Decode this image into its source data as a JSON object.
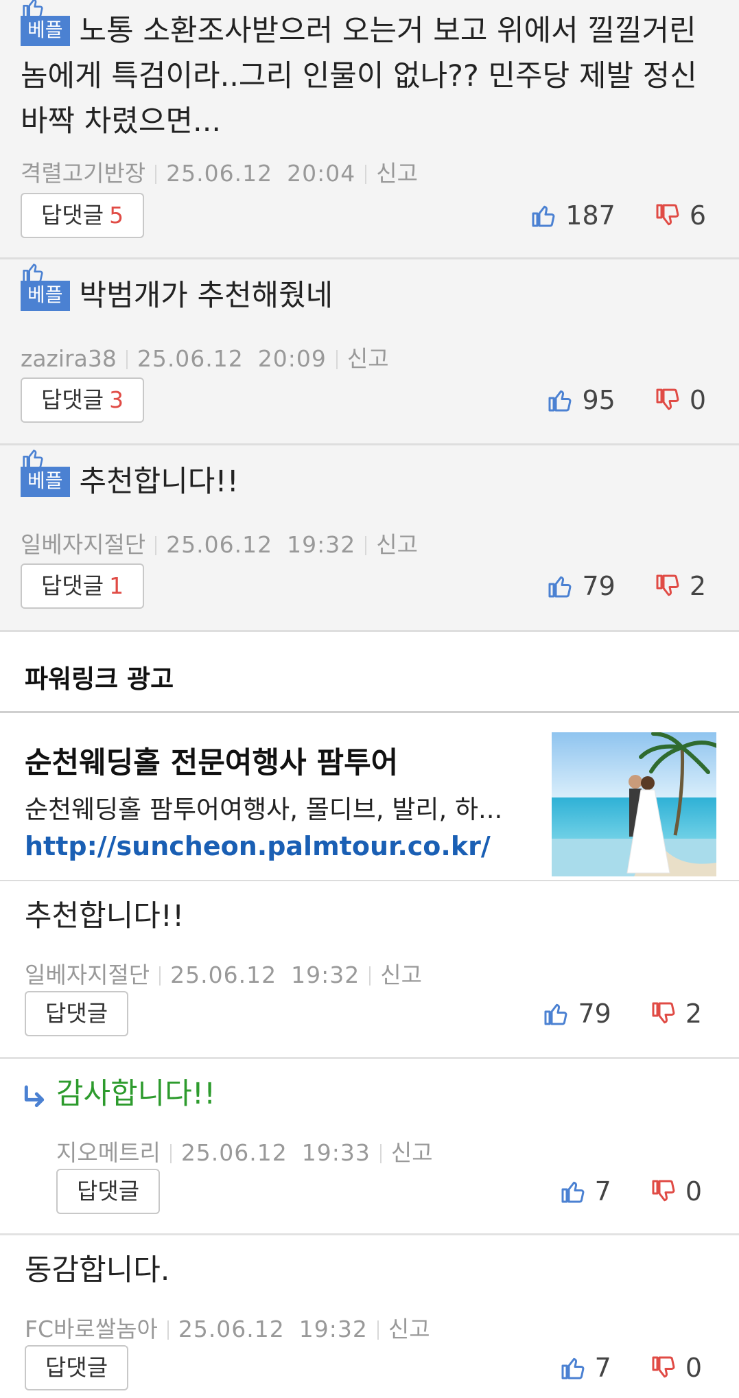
{
  "best_label": "베플",
  "report_label": "신고",
  "reply_label": "답댓글",
  "best_comments": [
    {
      "text": "노통 소환조사받으러 오는거 보고 위에서 낄낄거린 놈에게 특검이라..그리 인물이 없나?? 민주당 제발 정신 바짝 차렸으면...",
      "author": "격렬고기반장",
      "date": "25.06.12",
      "time": "20:04",
      "reply_count": "5",
      "up": "187",
      "down": "6"
    },
    {
      "text": "박범개가 추천해줬네",
      "author": "zazira38",
      "date": "25.06.12",
      "time": "20:09",
      "reply_count": "3",
      "up": "95",
      "down": "0"
    },
    {
      "text": "추천합니다!!",
      "author": "일베자지절단",
      "date": "25.06.12",
      "time": "19:32",
      "reply_count": "1",
      "up": "79",
      "down": "2"
    }
  ],
  "ad_section": {
    "header": "파워링크 광고",
    "title": "순천웨딩홀 전문여행사 팜투어",
    "description": "순천웨딩홀 팜투어여행사, 몰디브, 발리, 하...",
    "url": "http://suncheon.palmtour.co.kr/"
  },
  "comments": [
    {
      "text": "추천합니다!!",
      "author": "일베자지절단",
      "date": "25.06.12",
      "time": "19:32",
      "up": "79",
      "down": "2"
    },
    {
      "text": "감사합니다!!",
      "author": "지오메트리",
      "date": "25.06.12",
      "time": "19:33",
      "up": "7",
      "down": "0"
    },
    {
      "text": "동감합니다.",
      "author": "FC바로쌀놈아",
      "date": "25.06.12",
      "time": "19:32",
      "up": "7",
      "down": "0"
    }
  ],
  "colors": {
    "badge": "#4b81d2",
    "reply_count": "#e04b45",
    "thumb_up": "#4b81d2",
    "thumb_down": "#e04b45",
    "reply_text": "#2d9b2d",
    "ad_url": "#1a5fb4"
  },
  "icons": {
    "up": "thumbs-up-icon",
    "down": "thumbs-down-icon",
    "reply_arrow": "reply-arrow-icon"
  }
}
